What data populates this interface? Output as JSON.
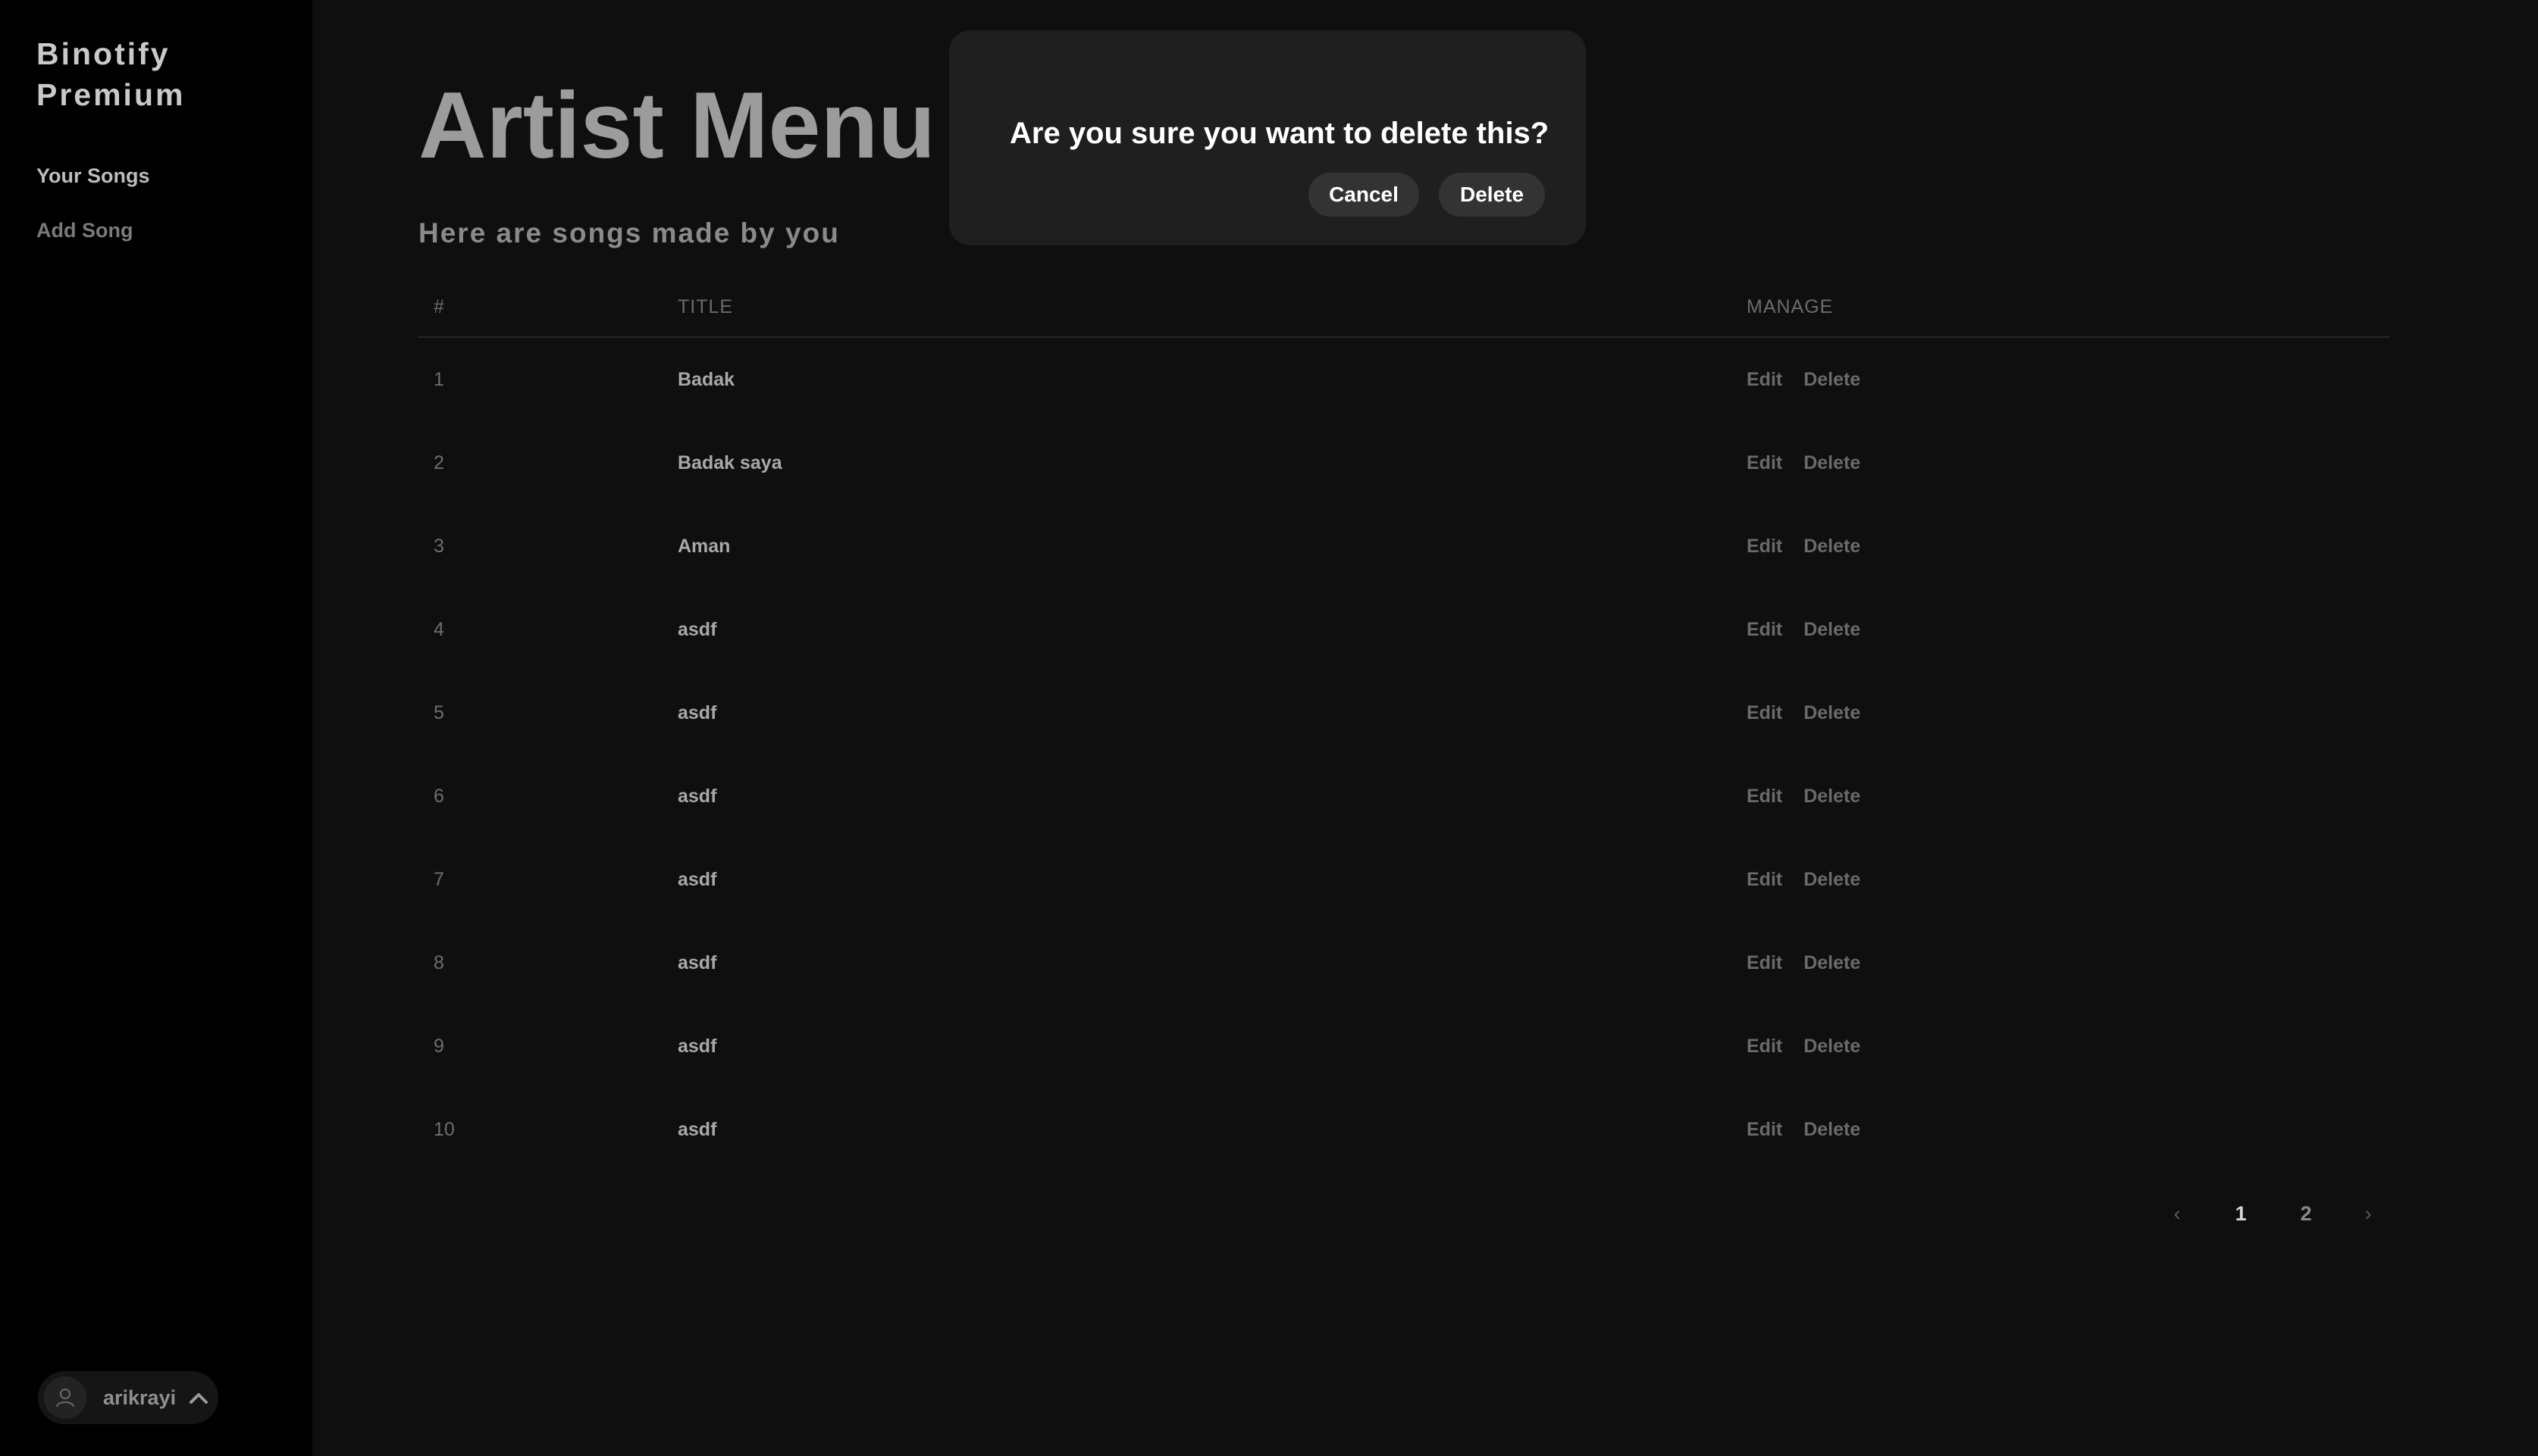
{
  "sidebar": {
    "brand": "Binotify Premium",
    "items": [
      {
        "label": "Your Songs",
        "active": true
      },
      {
        "label": "Add Song",
        "active": false
      }
    ],
    "user": {
      "name": "arikrayi"
    }
  },
  "main": {
    "title": "Artist Menu",
    "subtitle": "Here are songs made by you",
    "table": {
      "headers": {
        "num": "#",
        "title": "TITLE",
        "manage": "MANAGE"
      },
      "rows": [
        {
          "num": "1",
          "title": "Badak",
          "edit": "Edit",
          "delete": "Delete"
        },
        {
          "num": "2",
          "title": "Badak saya",
          "edit": "Edit",
          "delete": "Delete"
        },
        {
          "num": "3",
          "title": "Aman",
          "edit": "Edit",
          "delete": "Delete"
        },
        {
          "num": "4",
          "title": "asdf",
          "edit": "Edit",
          "delete": "Delete"
        },
        {
          "num": "5",
          "title": "asdf",
          "edit": "Edit",
          "delete": "Delete"
        },
        {
          "num": "6",
          "title": "asdf",
          "edit": "Edit",
          "delete": "Delete"
        },
        {
          "num": "7",
          "title": "asdf",
          "edit": "Edit",
          "delete": "Delete"
        },
        {
          "num": "8",
          "title": "asdf",
          "edit": "Edit",
          "delete": "Delete"
        },
        {
          "num": "9",
          "title": "asdf",
          "edit": "Edit",
          "delete": "Delete"
        },
        {
          "num": "10",
          "title": "asdf",
          "edit": "Edit",
          "delete": "Delete"
        }
      ]
    },
    "pagination": {
      "prev": "‹",
      "pages": [
        "1",
        "2"
      ],
      "current": "1",
      "next": "›"
    }
  },
  "modal": {
    "title": "Are you sure you want to delete this?",
    "cancel_label": "Cancel",
    "delete_label": "Delete"
  }
}
